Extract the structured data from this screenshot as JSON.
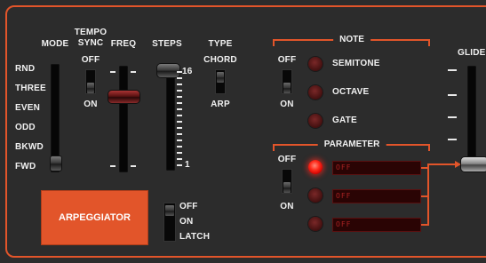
{
  "mode": {
    "label": "MODE",
    "options": [
      "RND",
      "THREE",
      "EVEN",
      "ODD",
      "BKWD",
      "FWD"
    ]
  },
  "tempo_sync": {
    "label_line1": "TEMPO",
    "label_line2": "SYNC",
    "off": "OFF",
    "on": "ON"
  },
  "freq": {
    "label": "FREQ"
  },
  "steps": {
    "label": "STEPS",
    "max": "16",
    "min": "1"
  },
  "type": {
    "label": "TYPE",
    "opt1": "CHORD",
    "opt2": "ARP"
  },
  "note": {
    "title": "NOTE",
    "off": "OFF",
    "on": "ON",
    "items": [
      "SEMITONE",
      "OCTAVE",
      "GATE"
    ]
  },
  "parameter": {
    "title": "PARAMETER",
    "off": "OFF",
    "on": "ON",
    "displays": [
      "OFF",
      "OFF",
      "OFF"
    ]
  },
  "glide": {
    "label": "GLIDE"
  },
  "arpeggiator": {
    "label": "ARPEGGIATOR"
  },
  "latch": {
    "off": "OFF",
    "on": "ON",
    "latch": "LATCH"
  },
  "colors": {
    "accent": "#e2552a",
    "panel": "#2c2c2c",
    "led_on": "#ff2a1a"
  }
}
